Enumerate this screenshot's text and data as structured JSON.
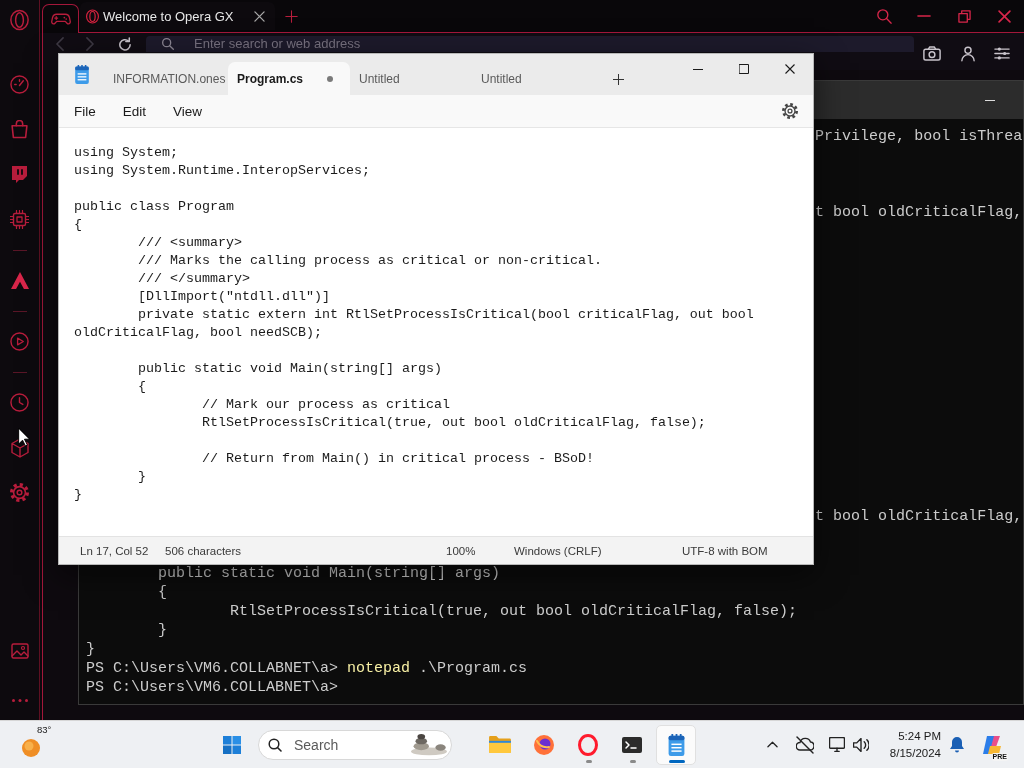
{
  "browser": {
    "tabs": [
      {
        "label": "Welcome to Opera GX"
      }
    ],
    "address_bar": {
      "placeholder": "Enter search or web address"
    }
  },
  "terminal": {
    "fragments": [
      "Privilege, bool isThrea",
      "t bool oldCriticalFlag,",
      "t bool oldCriticalFlag,"
    ],
    "lines": [
      {
        "kind": "output",
        "text": "\tpublic static void Main(string[] args)"
      },
      {
        "kind": "output",
        "text": "\t{"
      },
      {
        "kind": "output",
        "text": "\t\tRtlSetProcessIsCritical(true, out bool oldCriticalFlag, false);"
      },
      {
        "kind": "output",
        "text": "\t}"
      },
      {
        "kind": "output",
        "text": "}"
      },
      {
        "kind": "prompt",
        "prompt": "PS C:\\Users\\VM6.COLLABNET\\a>",
        "command": "notepad",
        "args": ".\\Program.cs"
      },
      {
        "kind": "prompt",
        "prompt": "PS C:\\Users\\VM6.COLLABNET\\a>"
      }
    ]
  },
  "notepad": {
    "tabs": [
      {
        "label": "INFORMATION.ones",
        "selected": false,
        "modified": false
      },
      {
        "label": "Program.cs",
        "selected": true,
        "modified": true
      },
      {
        "label": "Untitled",
        "selected": false,
        "modified": false
      },
      {
        "label": "Untitled",
        "selected": false,
        "modified": false
      }
    ],
    "menu": [
      "File",
      "Edit",
      "View"
    ],
    "code": [
      [
        "using System;",
        "using System.Runtime.InteropServices;"
      ],
      [
        "public class Program",
        "{",
        "\t/// <summary>",
        "\t/// Marks the calling process as critical or non-critical.",
        "\t/// </summary>",
        "\t[DllImport(\"ntdll.dll\")]",
        "\tprivate static extern int RtlSetProcessIsCritical(bool criticalFlag, out bool",
        "oldCriticalFlag, bool needSCB);"
      ],
      [
        "\tpublic static void Main(string[] args)",
        "\t{",
        "\t\t// Mark our process as critical",
        "\t\tRtlSetProcessIsCritical(true, out bool oldCriticalFlag, false);"
      ],
      [
        "\t\t// Return from Main() in critical process - BSoD!",
        "\t}",
        "}"
      ]
    ],
    "status_bar": {
      "position": "Ln 17, Col 52",
      "characters": "506 characters",
      "zoom": "100%",
      "line_ending": "Windows (CRLF)",
      "encoding": "UTF-8 with BOM"
    }
  },
  "taskbar": {
    "weather": {
      "temperature": "83°"
    },
    "search": {
      "placeholder": "Search"
    },
    "apps": [
      {
        "kind": "folder",
        "running": false,
        "selected": false
      },
      {
        "kind": "globe",
        "running": false,
        "selected": false
      },
      {
        "kind": "ring",
        "running": true,
        "selected": false
      },
      {
        "kind": "terminal",
        "running": true,
        "selected": false
      },
      {
        "kind": "notepad",
        "running": true,
        "selected": true
      }
    ],
    "clock": {
      "time": "5:24 PM",
      "date": "8/15/2024"
    },
    "assistant_badge": "PRE"
  }
}
